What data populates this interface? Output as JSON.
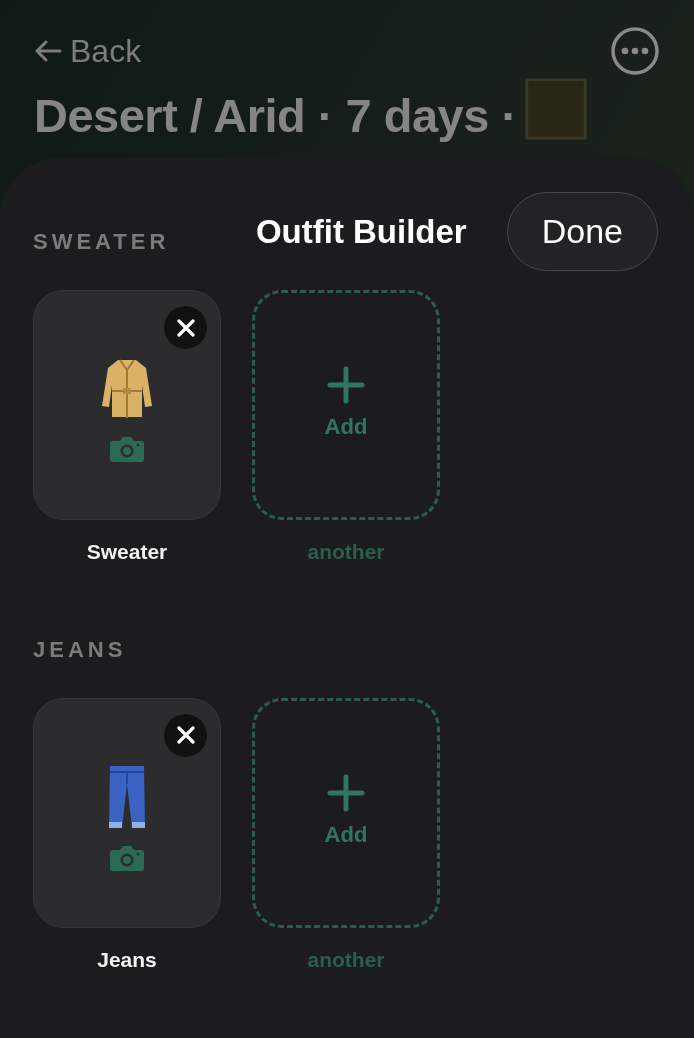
{
  "top_bar": {
    "back": "Back",
    "title": "Desert / Arid · 7 days ·"
  },
  "sheet": {
    "title": "Outfit Builder",
    "done_button": "Done"
  },
  "sections": [
    {
      "heading": "SWEATER",
      "items": [
        {
          "kind": "coat",
          "label": "Sweater"
        }
      ],
      "add_tile": {
        "label": "Add",
        "caption": "another"
      }
    },
    {
      "heading": "JEANS",
      "items": [
        {
          "kind": "jeans",
          "label": "Jeans"
        }
      ],
      "add_tile": {
        "label": "Add",
        "caption": "another"
      }
    }
  ]
}
